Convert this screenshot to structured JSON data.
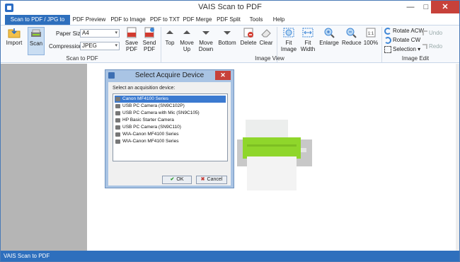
{
  "app": {
    "title": "VAIS Scan to PDF"
  },
  "window_controls": {
    "minimize": "—",
    "maximize": "□",
    "close": "✕"
  },
  "tabs": [
    {
      "label": "Scan to PDF / JPG to PDF",
      "active": true
    },
    {
      "label": "PDF Preview"
    },
    {
      "label": "PDF to Image"
    },
    {
      "label": "PDF to TXT"
    },
    {
      "label": "PDF Merge"
    },
    {
      "label": "PDF Split"
    },
    {
      "label": "Tools"
    },
    {
      "label": "Help"
    }
  ],
  "ribbon": {
    "import": "Import",
    "scan": "Scan",
    "paper_size_label": "Paper Size",
    "paper_size_value": "A4",
    "compression_label": "Compression",
    "compression_value": "JPEG",
    "save_pdf": [
      "Save",
      "PDF"
    ],
    "send_pdf": [
      "Send",
      "PDF"
    ],
    "group_scan": "Scan to PDF",
    "top": "Top",
    "move_up": [
      "Move",
      "Up"
    ],
    "move_down": [
      "Move",
      "Down"
    ],
    "bottom": "Bottom",
    "delete": "Delete",
    "clear": "Clear",
    "fit_image": [
      "Fit",
      "Image"
    ],
    "fit_width": [
      "Fit",
      "Width"
    ],
    "enlarge": "Enlarge",
    "reduce": "Reduce",
    "zoom_100": "100%",
    "group_view": "Image View",
    "rotate_acw": "Rotate ACW",
    "rotate_cw": "Rotate CW",
    "selection": "Selection",
    "undo": "Undo",
    "redo": "Redo",
    "group_edit": "Image Edit"
  },
  "dialog": {
    "title": "Select Acquire Device",
    "label": "Select an acquisition device:",
    "devices": [
      "Canon MF4100 Series",
      "USB PC Camera (SN9C102P)",
      "USB PC Camera with Mic (SN9C105)",
      "HP Basic Starter Camera",
      "USB PC Camera (SN9C110)",
      "WIA-Canon MF4100 Series",
      "WIA-Canon MF4100 Series"
    ],
    "selected_index": 0,
    "ok": "OK",
    "cancel": "Cancel"
  },
  "status": "VAIS Scan to PDF",
  "colors": {
    "accent": "#2e6fbd",
    "scanner_green": "#8fd62b",
    "close_red": "#c7413a"
  }
}
